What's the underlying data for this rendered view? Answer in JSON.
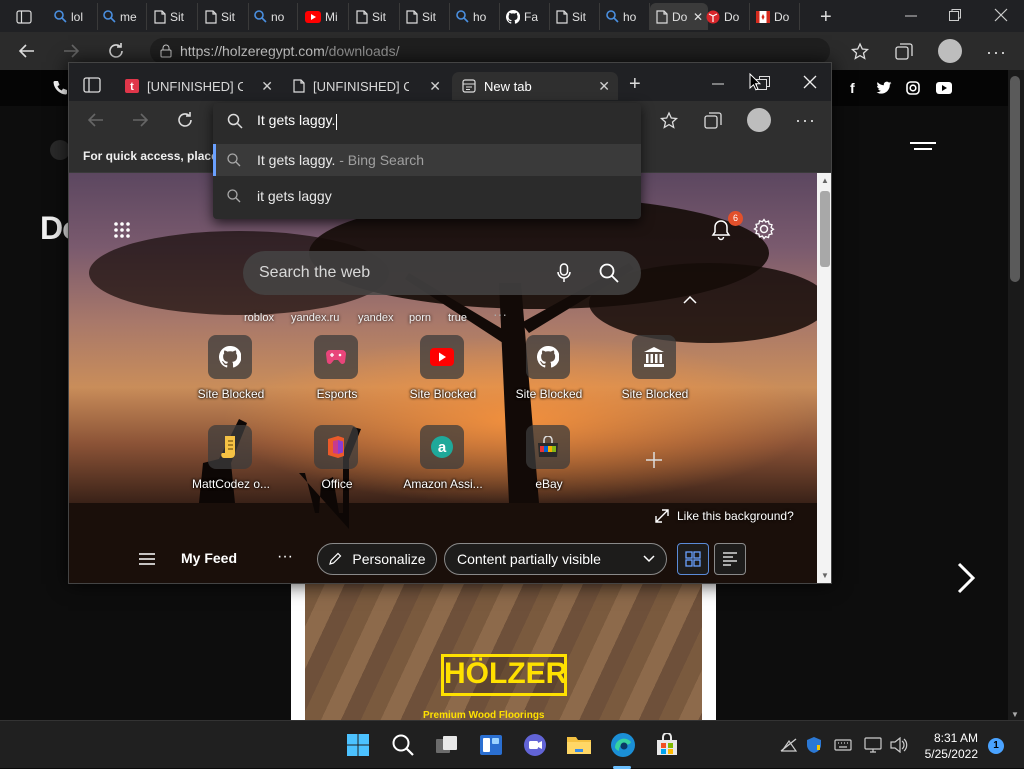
{
  "outer_browser": {
    "tabs": [
      {
        "label": "",
        "icon": "tab-actions-icon"
      },
      {
        "label": "lol",
        "icon": "search-icon"
      },
      {
        "label": "me",
        "icon": "search-icon"
      },
      {
        "label": "Sit",
        "icon": "page-icon"
      },
      {
        "label": "Sit",
        "icon": "page-icon"
      },
      {
        "label": "no",
        "icon": "search-icon"
      },
      {
        "label": "Mi",
        "icon": "youtube-icon"
      },
      {
        "label": "Sit",
        "icon": "page-icon"
      },
      {
        "label": "Sit",
        "icon": "page-icon"
      },
      {
        "label": "ho",
        "icon": "search-icon"
      },
      {
        "label": "Fa",
        "icon": "github-icon"
      },
      {
        "label": "Sit",
        "icon": "page-icon"
      },
      {
        "label": "ho",
        "icon": "search-icon"
      },
      {
        "label": "Do",
        "icon": "page-icon"
      },
      {
        "label": "Do",
        "icon": "ball-icon"
      },
      {
        "label": "Do",
        "icon": "flag-icon"
      }
    ],
    "address": {
      "url_main": "https://holzeregypt.com",
      "url_rest": "/downloads/"
    }
  },
  "website": {
    "hero_title": "Do",
    "logo_text": "HÖLZER",
    "tagline": "Premium Wood Floorings"
  },
  "inner_browser": {
    "tabs": [
      {
        "label": "[UNFINISHED] Cor",
        "icon": "tumblr-icon"
      },
      {
        "label": "[UNFINISHED] Cor",
        "icon": "page-icon"
      },
      {
        "label": "New tab",
        "icon": "newtab-icon"
      }
    ],
    "favbar_text": "For quick access, place y",
    "omnibox": {
      "input_value": "It gets laggy.",
      "suggestions": [
        {
          "text": "It gets laggy.",
          "sub": " - Bing Search"
        },
        {
          "text": "it gets laggy",
          "sub": ""
        }
      ]
    },
    "ntp": {
      "notification_count": "6",
      "search_placeholder": "Search the web",
      "quick_links": [
        "roblox",
        "yandex.ru",
        "yandex",
        "porn",
        "true"
      ],
      "tiles": [
        {
          "label": "Site Blocked",
          "icon": "github-icon"
        },
        {
          "label": "Esports",
          "icon": "gamepad-icon"
        },
        {
          "label": "Site Blocked",
          "icon": "youtube-icon"
        },
        {
          "label": "Site Blocked",
          "icon": "github-icon"
        },
        {
          "label": "Site Blocked",
          "icon": "bank-icon"
        },
        {
          "label": "MattCodez o...",
          "icon": "script-icon"
        },
        {
          "label": "Office",
          "icon": "office-icon"
        },
        {
          "label": "Amazon Assi...",
          "icon": "amazon-icon"
        },
        {
          "label": "eBay",
          "icon": "ebay-icon"
        }
      ],
      "bg_link": "Like this background?",
      "feed": {
        "my_feed": "My Feed",
        "personalize": "Personalize",
        "content_select": "Content partially visible"
      }
    }
  },
  "taskbar": {
    "time": "8:31 AM",
    "date": "5/25/2022",
    "notification_count": "1"
  }
}
